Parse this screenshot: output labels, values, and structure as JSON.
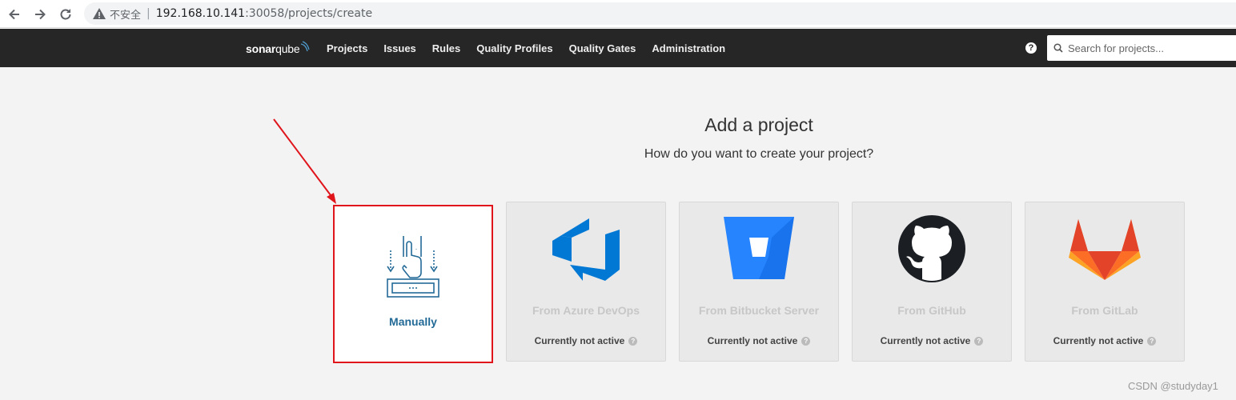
{
  "browser": {
    "insecure_label": "不安全",
    "separator": "|",
    "url_host": "192.168.10.141",
    "url_path": ":30058/projects/create"
  },
  "nav": {
    "logo_bold": "sonar",
    "logo_light": "qube",
    "items": [
      "Projects",
      "Issues",
      "Rules",
      "Quality Profiles",
      "Quality Gates",
      "Administration"
    ],
    "help_label": "?",
    "search_placeholder": "Search for projects..."
  },
  "main": {
    "title": "Add a project",
    "subtitle": "How do you want to create your project?",
    "cards": [
      {
        "label": "Manually"
      },
      {
        "label": "From Azure DevOps",
        "status": "Currently not active"
      },
      {
        "label": "From Bitbucket Server",
        "status": "Currently not active"
      },
      {
        "label": "From GitHub",
        "status": "Currently not active"
      },
      {
        "label": "From GitLab",
        "status": "Currently not active"
      }
    ],
    "status_help": "?"
  },
  "colors": {
    "nav_bg": "#262626",
    "highlight_border": "#e0151c",
    "manual_label": "#236a97",
    "azure": "#0078d4",
    "bitbucket": "#2684ff",
    "gitlab_orange": "#fc6d26"
  },
  "watermark": "CSDN @studyday1"
}
